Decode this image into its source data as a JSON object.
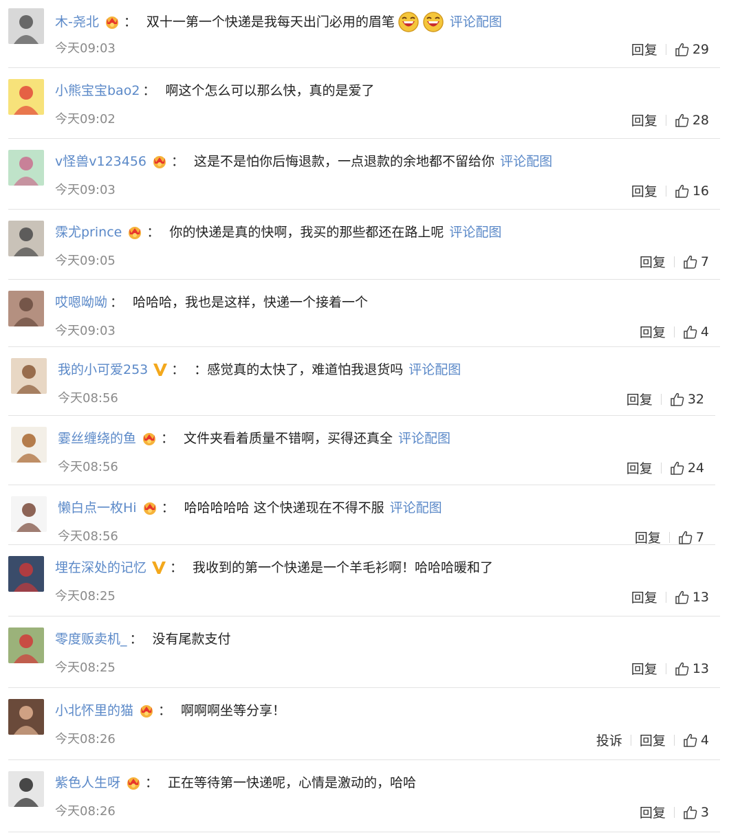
{
  "colors": {
    "link": "#5b89c8",
    "text": "#222222",
    "meta": "#8a8a8a",
    "divider": "#e3e3e3"
  },
  "comments": [
    {
      "user": "木-尧北",
      "badge": "crown-icon",
      "text": "双十一第一个快递是我每天出门必用的眉笔",
      "emoji_count": 2,
      "pic_link": "评论配图",
      "time": "今天09:03",
      "report": "",
      "reply": "回复",
      "likes": "29",
      "avatar_colors": [
        "#d8d8d8",
        "#555555"
      ]
    },
    {
      "user": "小熊宝宝bao2",
      "badge": "",
      "text": "啊这个怎么可以那么快，真的是爱了",
      "emoji_count": 0,
      "pic_link": "",
      "time": "今天09:02",
      "report": "",
      "reply": "回复",
      "likes": "28",
      "avatar_colors": [
        "#f7e27a",
        "#e24a3b"
      ]
    },
    {
      "user": "v怪兽v123456",
      "badge": "crown-icon",
      "text": "这是不是怕你后悔退款，一点退款的余地都不留给你",
      "emoji_count": 0,
      "pic_link": "评论配图",
      "time": "今天09:03",
      "report": "",
      "reply": "回复",
      "likes": "16",
      "avatar_colors": [
        "#bfe3c9",
        "#c9708f"
      ]
    },
    {
      "user": "霂尤prince",
      "badge": "crown-icon",
      "text": "你的快递是真的快啊，我买的那些都还在路上呢",
      "emoji_count": 0,
      "pic_link": "评论配图",
      "time": "今天09:05",
      "report": "",
      "reply": "回复",
      "likes": "7",
      "avatar_colors": [
        "#c9c2b8",
        "#4a4a4a"
      ]
    },
    {
      "user": "哎嗯呦呦",
      "badge": "",
      "text": "哈哈哈，我也是这样，快递一个接着一个",
      "emoji_count": 0,
      "pic_link": "",
      "time": "今天09:03",
      "report": "",
      "reply": "回复",
      "likes": "4",
      "avatar_colors": [
        "#b49080",
        "#6a4c3f"
      ]
    },
    {
      "user": "我的小可爱253",
      "badge": "v-icon",
      "text": "：感觉真的太快了，难道怕我退货吗",
      "emoji_count": 0,
      "pic_link": "评论配图",
      "time": "今天08:56",
      "report": "",
      "reply": "回复",
      "likes": "32",
      "avatar_colors": [
        "#e8d7c4",
        "#8a5a38"
      ]
    },
    {
      "user": "霎丝缠绕的鱼",
      "badge": "crown-icon",
      "text": "文件夹看着质量不错啊，买得还真全",
      "emoji_count": 0,
      "pic_link": "评论配图",
      "time": "今天08:56",
      "report": "",
      "reply": "回复",
      "likes": "24",
      "avatar_colors": [
        "#f3efe7",
        "#a8672f"
      ]
    },
    {
      "user": "懒白点一枚Hi",
      "badge": "crown-icon",
      "text": "哈哈哈哈哈 这个快递现在不得不服",
      "emoji_count": 0,
      "pic_link": "评论配图",
      "time": "今天08:56",
      "report": "",
      "reply": "回复",
      "likes": "7",
      "avatar_colors": [
        "#f5f5f5",
        "#7a4a3a"
      ]
    },
    {
      "user": "埋在深处的记忆",
      "badge": "v-icon",
      "text": "我收到的第一个快递是一个羊毛衫啊！哈哈哈暖和了",
      "emoji_count": 0,
      "pic_link": "",
      "time": "今天08:25",
      "report": "",
      "reply": "回复",
      "likes": "13",
      "avatar_colors": [
        "#3a4c6a",
        "#c43a3a"
      ]
    },
    {
      "user": "零度贩卖机_",
      "badge": "",
      "text": "没有尾款支付",
      "emoji_count": 0,
      "pic_link": "",
      "time": "今天08:25",
      "report": "",
      "reply": "回复",
      "likes": "13",
      "avatar_colors": [
        "#9bb27a",
        "#d03a3a"
      ]
    },
    {
      "user": "小北怀里的猫",
      "badge": "crown-icon",
      "text": "啊啊啊坐等分享！",
      "emoji_count": 0,
      "pic_link": "",
      "time": "今天08:26",
      "report": "投诉",
      "reply": "回复",
      "likes": "4",
      "avatar_colors": [
        "#6a4a3a",
        "#e0b090"
      ]
    },
    {
      "user": "紫色人生呀",
      "badge": "crown-icon",
      "text": "正在等待第一快递呢，心情是激动的，哈哈",
      "emoji_count": 0,
      "pic_link": "",
      "time": "今天08:26",
      "report": "",
      "reply": "回复",
      "likes": "3",
      "avatar_colors": [
        "#e6e6e6",
        "#2a2a2a"
      ]
    }
  ]
}
